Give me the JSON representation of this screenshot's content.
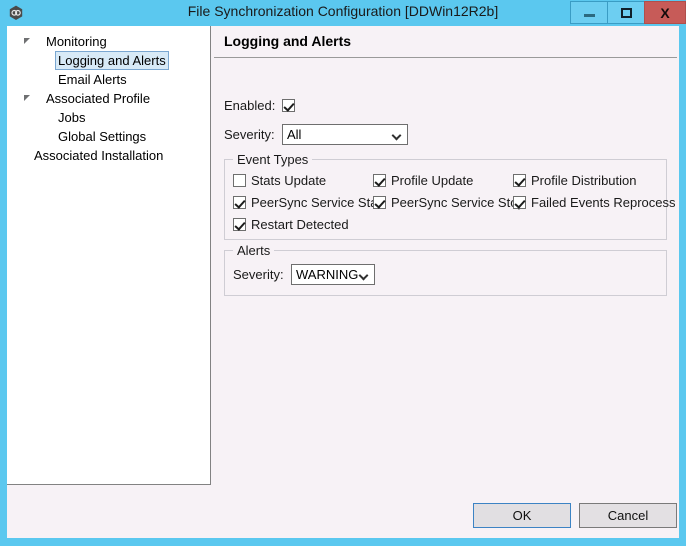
{
  "window": {
    "title": "File Synchronization Configuration [DDWin12R2b]",
    "app_icon": "sync-rings-icon",
    "accent_color": "#5bc8ef",
    "close_color": "#c75b58",
    "controls": {
      "minimize": "–",
      "maximize": "□",
      "close": "X"
    }
  },
  "sidebar": {
    "items": [
      {
        "label": "Monitoring",
        "level": 0,
        "expander": true,
        "selected": false
      },
      {
        "label": "Logging and Alerts",
        "level": 1,
        "expander": false,
        "selected": true
      },
      {
        "label": "Email Alerts",
        "level": 1,
        "expander": false,
        "selected": false
      },
      {
        "label": "Associated Profile",
        "level": 0,
        "expander": true,
        "selected": false
      },
      {
        "label": "Jobs",
        "level": 1,
        "expander": false,
        "selected": false
      },
      {
        "label": "Global Settings",
        "level": 1,
        "expander": false,
        "selected": false
      },
      {
        "label": "Associated Installation",
        "level": 0,
        "expander": false,
        "selected": false
      }
    ]
  },
  "main": {
    "page_title": "Logging and Alerts",
    "enabled": {
      "label": "Enabled:",
      "checked": true
    },
    "severity": {
      "label": "Severity:",
      "value": "All",
      "options": [
        "All"
      ]
    },
    "event_types": {
      "title": "Event Types",
      "items": [
        {
          "label": "Stats Update",
          "checked": false
        },
        {
          "label": "Profile Update",
          "checked": true
        },
        {
          "label": "Profile Distribution",
          "checked": true
        },
        {
          "label": "PeerSync Service Start",
          "checked": true
        },
        {
          "label": "PeerSync Service Stop",
          "checked": true
        },
        {
          "label": "Failed Events Reprocess",
          "checked": true
        },
        {
          "label": "Restart Detected",
          "checked": true
        }
      ]
    },
    "alerts": {
      "title": "Alerts",
      "severity": {
        "label": "Severity:",
        "value": "WARNING",
        "options": [
          "WARNING"
        ]
      }
    }
  },
  "footer": {
    "ok_label": "OK",
    "cancel_label": "Cancel"
  }
}
